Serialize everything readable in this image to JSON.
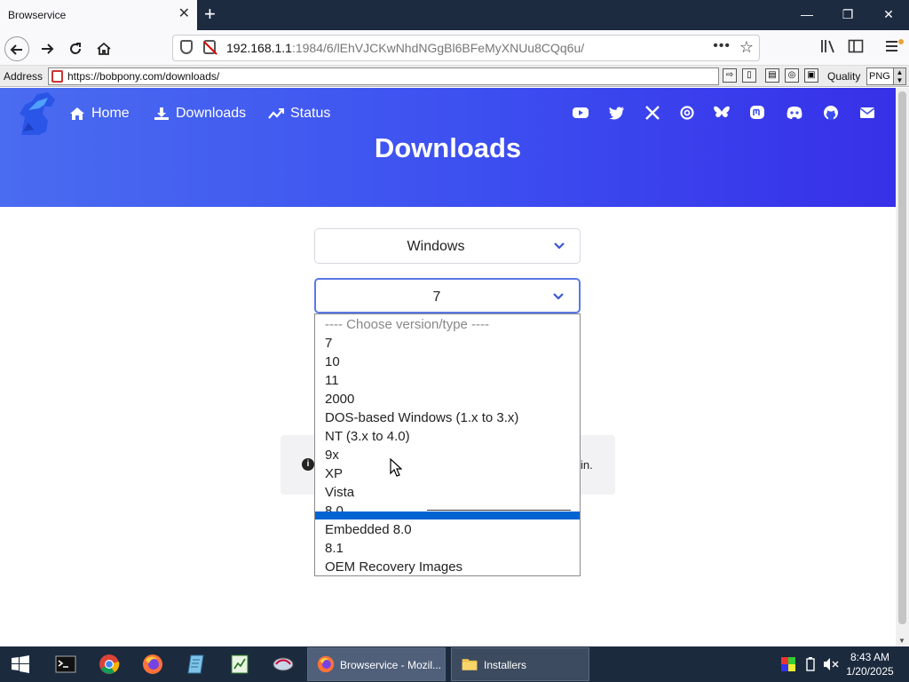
{
  "browser": {
    "tab_title": "Browservice",
    "tab_close": "✕",
    "new_tab": "+",
    "window_controls": {
      "minimize": "—",
      "restore": "❐",
      "close": "✕"
    },
    "url_host": "192.168.1.1",
    "url_rest": ":1984/6/lEhVJCKwNhdNGgBl6BFeMyXNUu8CQq6u/",
    "url_more": "•••",
    "bookmark_star": "☆"
  },
  "addressbar": {
    "label": "Address",
    "url": "https://bobpony.com/downloads/",
    "quality_label": "Quality",
    "quality_value": "PNG"
  },
  "site": {
    "nav": [
      {
        "label": "Home",
        "icon": "home-icon"
      },
      {
        "label": "Downloads",
        "icon": "download-icon"
      },
      {
        "label": "Status",
        "icon": "trend-icon"
      }
    ],
    "social_icons": [
      "youtube-icon",
      "twitter-icon",
      "x-icon",
      "threads-icon",
      "bluesky-icon",
      "mastodon-icon",
      "discord-icon",
      "github-icon",
      "mail-icon"
    ],
    "title": "Downloads",
    "os_select": "Windows",
    "version_select": "7",
    "alert_tail": "in."
  },
  "dropdown": {
    "options": [
      "---- Choose version/type ----",
      "7",
      "10",
      "11",
      "2000",
      "DOS-based Windows (1.x to 3.x)",
      "NT (3.x to 4.0)",
      "9x",
      "XP",
      "Vista",
      "8.0",
      "Embedded 8.0",
      "8.1",
      "OEM Recovery Images"
    ]
  },
  "taskbar": {
    "tasks": [
      {
        "label": "Browservice - Mozil...",
        "icon": "firefox-icon"
      },
      {
        "label": "Installers",
        "icon": "folder-icon"
      }
    ],
    "time": "8:43 AM",
    "date": "1/20/2025"
  },
  "colors": {
    "hero_start": "#4a6cf0",
    "hero_end": "#3730e8",
    "highlight": "#0064d2",
    "taskbar": "#1c2a3e"
  }
}
